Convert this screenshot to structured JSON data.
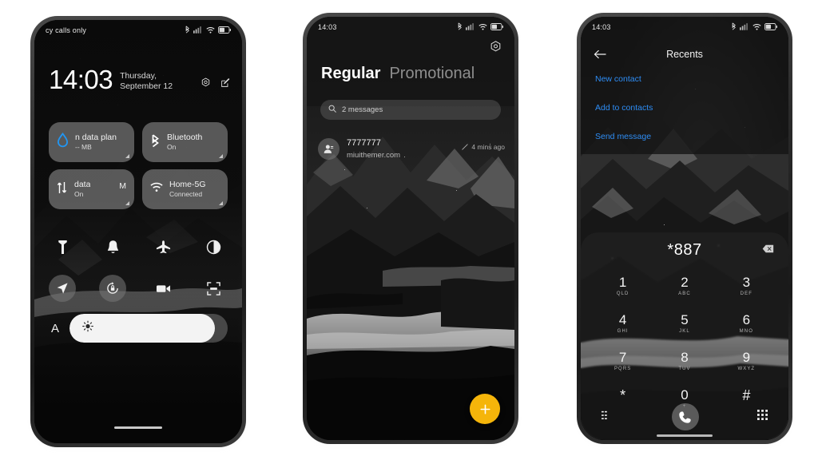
{
  "theme": {
    "background": "#ffffff",
    "accent_fab": "#f5b50a",
    "link_blue": "#2e8df5",
    "tile_bg": "#a0a0a0"
  },
  "phone1": {
    "name": "quick-settings-shade",
    "statusbar": {
      "carrier": "cy calls only",
      "icons": [
        "bluetooth-icon",
        "signal-icon",
        "wifi-icon",
        "battery-icon"
      ]
    },
    "clock": {
      "time": "14:03",
      "date": "Thursday, September 12"
    },
    "header_icons": [
      "settings-gear-icon",
      "edit-icon"
    ],
    "tiles": [
      {
        "title": "n data plan",
        "sub": "-- MB",
        "icon": "data-drop-icon",
        "extra": ""
      },
      {
        "title": "Bluetooth",
        "sub": "On",
        "icon": "bluetooth-icon",
        "extra": ""
      },
      {
        "title": "data",
        "sub": "On",
        "icon": "mobile-data-icon",
        "extra": "M"
      },
      {
        "title": "Home-5G",
        "sub": "Connected",
        "icon": "wifi-icon",
        "extra": ""
      }
    ],
    "toggles_row1": [
      "flashlight-icon",
      "bell-icon",
      "airplane-mode-icon",
      "dark-mode-icon"
    ],
    "toggles_row2": [
      "location-icon",
      "auto-rotate-lock-icon",
      "screen-record-icon",
      "screenshot-icon"
    ],
    "brightness": {
      "auto_label": "A",
      "icon": "brightness-sun-icon",
      "level_percent": 92
    }
  },
  "phone2": {
    "name": "messages-app",
    "statusbar": {
      "time": "14:03",
      "icons": [
        "bluetooth-icon",
        "signal-icon",
        "wifi-icon",
        "battery-icon"
      ]
    },
    "settings_icon": "settings-gear-icon",
    "tabs": [
      {
        "label": "Regular",
        "active": true
      },
      {
        "label": "Promotional",
        "active": false
      }
    ],
    "search": {
      "icon": "search-icon",
      "placeholder": "2 messages"
    },
    "messages": [
      {
        "sender": "7777777",
        "preview": "miuithemer.com",
        "time": "4 mins ago",
        "status_icon": "sent-pencil-icon",
        "avatar_icon": "contact-avatar-icon"
      }
    ],
    "fab": {
      "label": "+",
      "name": "new-message-fab"
    }
  },
  "phone3": {
    "name": "dialer-recents",
    "statusbar": {
      "time": "14:03",
      "icons": [
        "bluetooth-icon",
        "signal-icon",
        "wifi-icon",
        "battery-icon"
      ]
    },
    "header": {
      "back_icon": "back-arrow-icon",
      "title": "Recents"
    },
    "actions": [
      {
        "label": "New contact"
      },
      {
        "label": "Add to contacts"
      },
      {
        "label": "Send message"
      }
    ],
    "dialpad": {
      "number": "*887",
      "delete_icon": "backspace-icon",
      "keys": [
        {
          "digit": "1",
          "letters": "QLD"
        },
        {
          "digit": "2",
          "letters": "ABC"
        },
        {
          "digit": "3",
          "letters": "DEF"
        },
        {
          "digit": "4",
          "letters": "GHI"
        },
        {
          "digit": "5",
          "letters": "JKL"
        },
        {
          "digit": "6",
          "letters": "MNO"
        },
        {
          "digit": "7",
          "letters": "PQRS"
        },
        {
          "digit": "8",
          "letters": "TUV"
        },
        {
          "digit": "9",
          "letters": "WXYZ"
        },
        {
          "digit": "*",
          "letters": ""
        },
        {
          "digit": "0",
          "letters": "+"
        },
        {
          "digit": "#",
          "letters": ""
        }
      ],
      "bottom_bar": {
        "left_icon": "call-log-list-icon",
        "call_icon": "call-icon",
        "right_icon": "keypad-grid-icon"
      }
    }
  }
}
